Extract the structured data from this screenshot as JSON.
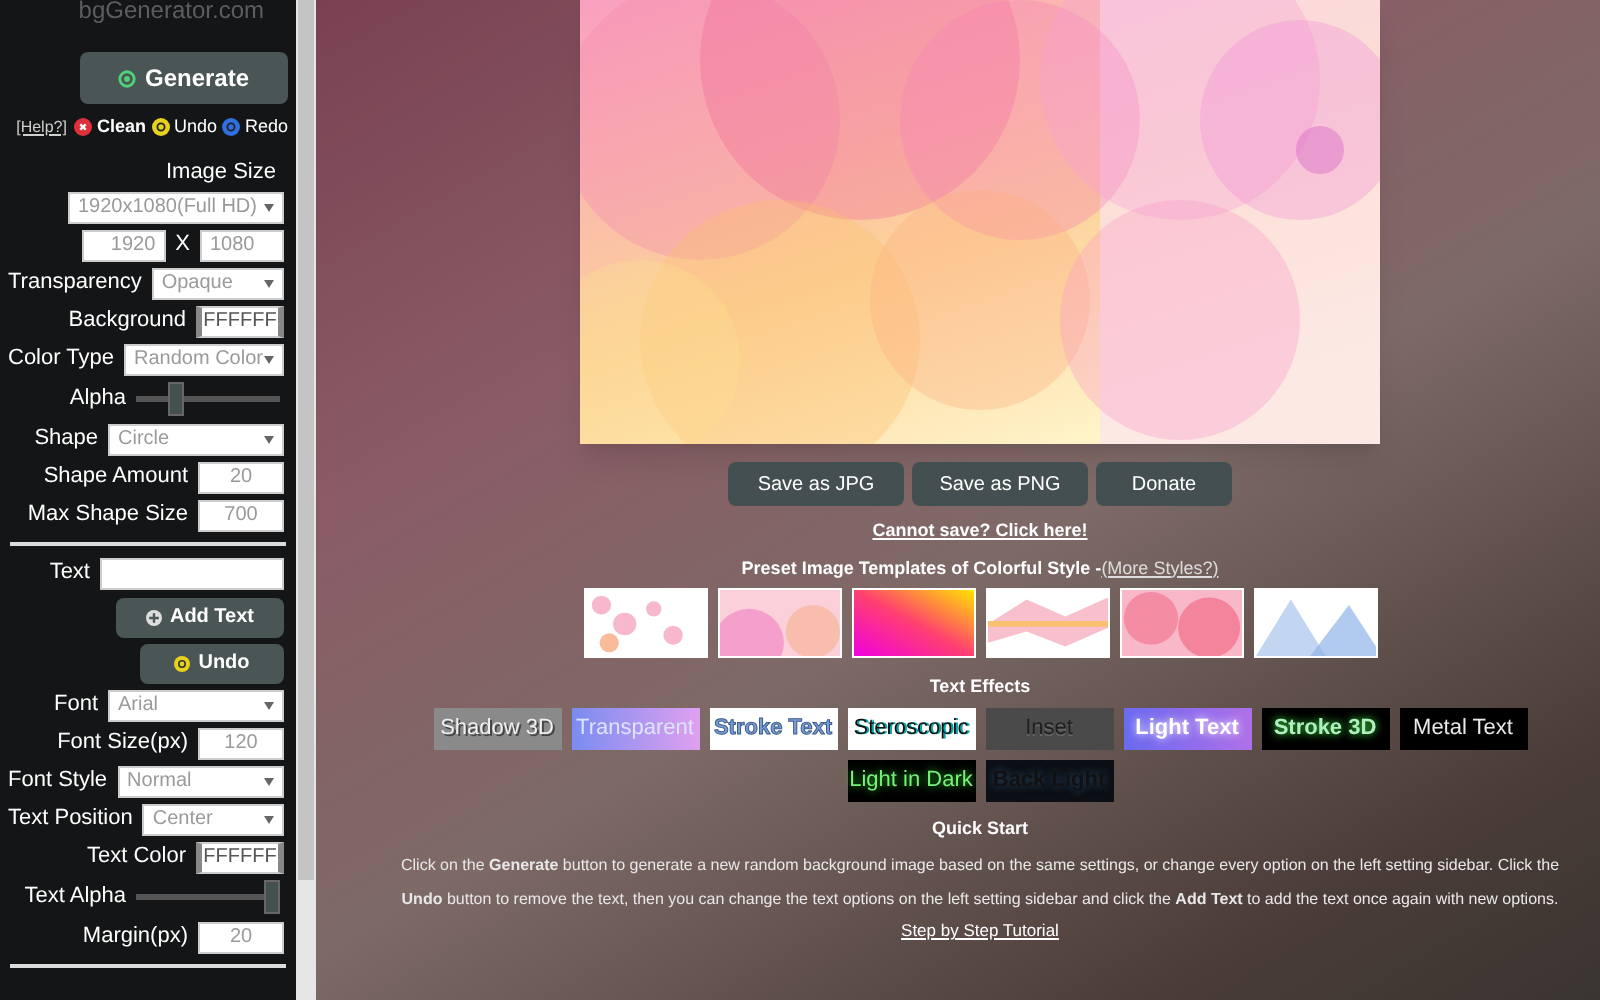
{
  "sidebar": {
    "site_title": "bgGenerator.com",
    "generate_button": "Generate",
    "help_link": "[Help?]",
    "actions": [
      {
        "kind": "clean",
        "label": "Clean",
        "color": "#e0303a"
      },
      {
        "kind": "undo",
        "label": "Undo",
        "color": "#e6d21c"
      },
      {
        "kind": "redo",
        "label": "Redo",
        "color": "#2f6fe0"
      }
    ],
    "rows": [
      {
        "kind": "heading",
        "label": "Image Size"
      },
      {
        "kind": "wide_select",
        "value": "1920x1080(Full HD)"
      },
      {
        "kind": "pair",
        "values": [
          "1920",
          "1080"
        ],
        "separator": "X"
      },
      {
        "kind": "select",
        "label": "Transparency",
        "value": "Opaque"
      },
      {
        "kind": "color",
        "label": "Background",
        "value": "FFFFFF"
      },
      {
        "kind": "select",
        "label": "Color Type",
        "value": "Random Color"
      },
      {
        "kind": "slider",
        "label": "Alpha",
        "level": 0.25
      },
      {
        "kind": "select",
        "label": "Shape",
        "value": "Circle"
      },
      {
        "kind": "input",
        "label": "Shape Amount",
        "value": "20"
      },
      {
        "kind": "input",
        "label": "Max Shape Size",
        "value": "700"
      },
      {
        "kind": "divider"
      },
      {
        "kind": "text",
        "label": "Text"
      },
      {
        "kind": "add_button",
        "label": "Add Text"
      },
      {
        "kind": "undo_button",
        "label": "Undo"
      },
      {
        "kind": "select",
        "label": "Font",
        "value": "Arial"
      },
      {
        "kind": "input",
        "label": "Font Size(px)",
        "value": "120"
      },
      {
        "kind": "select",
        "label": "Font Style",
        "value": "Normal"
      },
      {
        "kind": "select",
        "label": "Text Position",
        "value": "Center"
      },
      {
        "kind": "color",
        "label": "Text Color",
        "value": "FFFFFF"
      },
      {
        "kind": "slider",
        "label": "Text Alpha",
        "level": 1
      },
      {
        "kind": "input",
        "label": "Margin(px)",
        "value": "20"
      },
      {
        "kind": "divider"
      }
    ]
  },
  "main": {
    "save_buttons": [
      "Save as JPG",
      "Save as PNG",
      "Donate"
    ],
    "cannot_save_link": "Cannot save? Click here!",
    "presets_heading": "Preset Image Templates of Colorful Style - ",
    "more_styles_link": "(More Styles?)",
    "presets": [
      {
        "kind": "dots"
      },
      {
        "kind": "pink_circles"
      },
      {
        "kind": "gradient"
      },
      {
        "kind": "wave"
      },
      {
        "kind": "red_circles"
      },
      {
        "kind": "triangles"
      }
    ],
    "effects_heading": "Text Effects",
    "effects": [
      {
        "kind": "shadow3d",
        "label": "Shadow 3D"
      },
      {
        "kind": "transparent",
        "label": "Transparent"
      },
      {
        "kind": "stroke",
        "label": "Stroke Text"
      },
      {
        "kind": "stereoscopic",
        "label": "Steroscopic"
      },
      {
        "kind": "inset",
        "label": "Inset"
      },
      {
        "kind": "light",
        "label": "Light Text"
      },
      {
        "kind": "stroke3d",
        "label": "Stroke 3D"
      },
      {
        "kind": "metal",
        "label": "Metal Text"
      },
      {
        "kind": "lightdark",
        "label": "Light in Dark"
      },
      {
        "kind": "backlight",
        "label": "Back Light"
      }
    ],
    "quick_start_heading": "Quick Start",
    "quick_start_text": "Click on the **Generate** button to generate a new random background image based on the same settings, or change every option on the left setting sidebar. Click the **Undo** button to remove the text, then you can change the text options on the left setting sidebar and click the **Add Text** to add the text once again with new options.",
    "tutorial_link": "Step by Step Tutorial"
  }
}
